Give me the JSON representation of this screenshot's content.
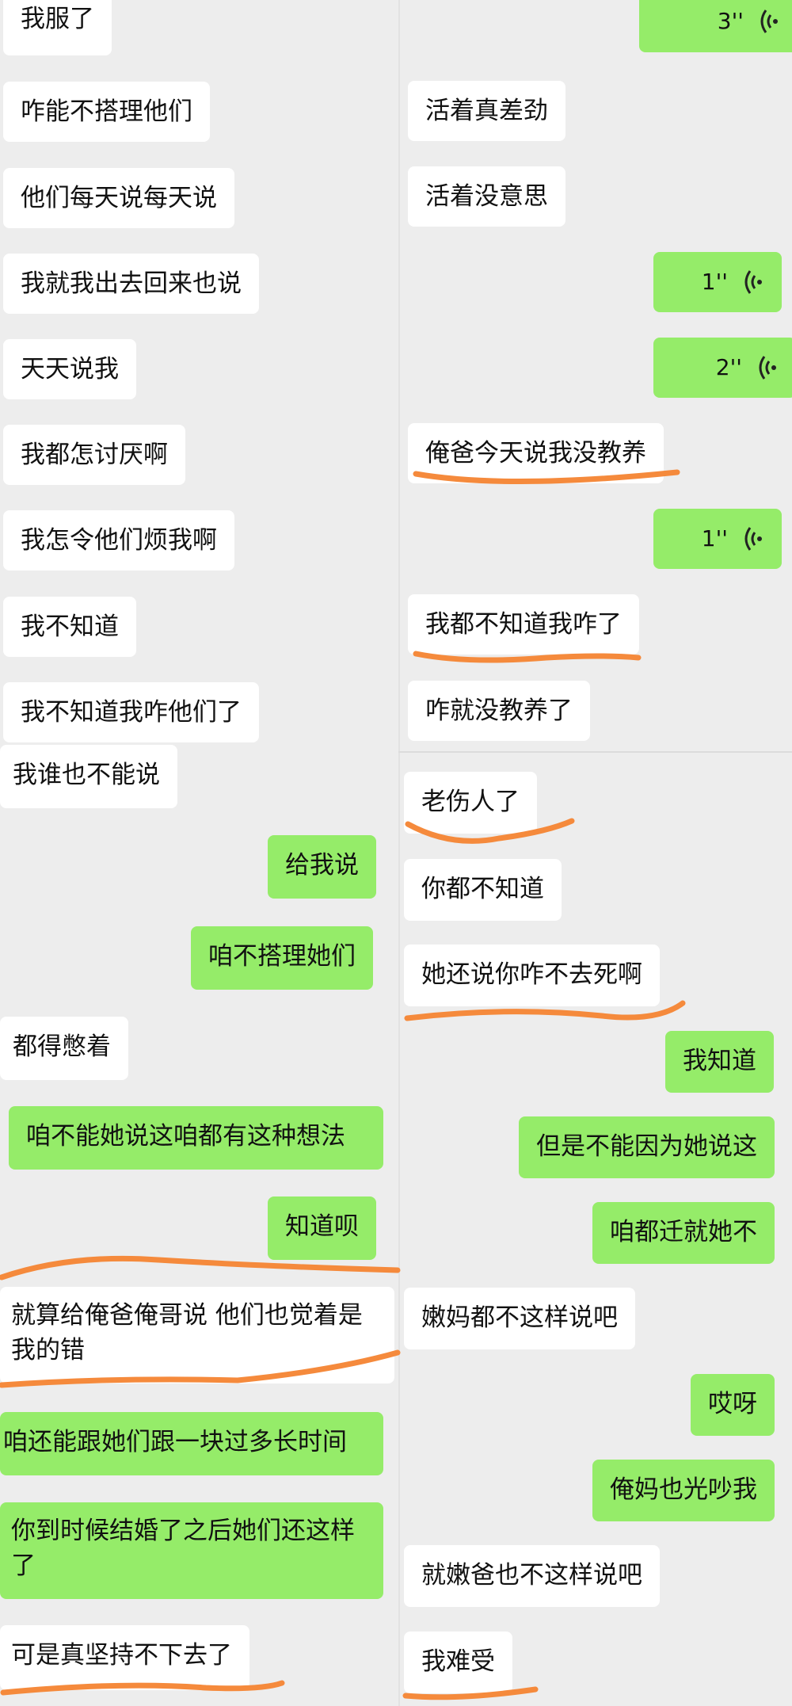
{
  "left_top": {
    "messages": [
      {
        "text": "我服了"
      },
      {
        "text": "咋能不搭理他们"
      },
      {
        "text": "他们每天说每天说"
      },
      {
        "text": "我就我出去回来也说"
      },
      {
        "text": "天天说我"
      },
      {
        "text": "我都怎讨厌啊"
      },
      {
        "text": "我怎令他们烦我啊"
      },
      {
        "text": "我不知道"
      },
      {
        "text": "我不知道我咋他们了"
      }
    ]
  },
  "right_top": {
    "voice_1": {
      "duration": "3''"
    },
    "messages": [
      {
        "text": "活着真差劲"
      },
      {
        "text": "活着没意思"
      }
    ],
    "voice_2": {
      "duration": "1''"
    },
    "voice_3": {
      "duration": "2''"
    },
    "msg_3": {
      "text": "俺爸今天说我没教养"
    },
    "voice_4": {
      "duration": "1''"
    },
    "msg_4": {
      "text": "我都不知道我咋了"
    },
    "msg_5": {
      "text": "咋就没教养了"
    }
  },
  "left_bottom": {
    "m1": {
      "text": "我谁也不能说"
    },
    "m2": {
      "text": "给我说"
    },
    "m3": {
      "text": "咱不搭理她们"
    },
    "m4": {
      "text": "都得憋着"
    },
    "m5": {
      "text": "咱不能她说这咱都有这种想法"
    },
    "m6": {
      "text": "知道呗"
    },
    "m7": {
      "text": "就算给俺爸俺哥说 他们也觉着是我的错"
    },
    "m8": {
      "text": "咱还能跟她们跟一块过多长时间"
    },
    "m9": {
      "text": "你到时候结婚了之后她们还这样了"
    },
    "m10": {
      "text": "可是真坚持不下去了"
    }
  },
  "right_bottom": {
    "m1": {
      "text": "老伤人了"
    },
    "m2": {
      "text": "你都不知道"
    },
    "m3": {
      "text": "她还说你咋不去死啊"
    },
    "m4": {
      "text": "我知道"
    },
    "m5": {
      "text": "但是不能因为她说这"
    },
    "m6": {
      "text": "咱都迁就她不"
    },
    "m7": {
      "text": "嫩妈都不这样说吧"
    },
    "m8": {
      "text": "哎呀"
    },
    "m9": {
      "text": "俺妈也光吵我"
    },
    "m10": {
      "text": "就嫩爸也不这样说吧"
    },
    "m11": {
      "text": "我难受"
    }
  },
  "colors": {
    "background": "#ededed",
    "incoming_bubble": "#ffffff",
    "outgoing_bubble": "#95ec69",
    "annotation": "#f58a3c"
  },
  "icons": {
    "voice": "voice-wave-icon"
  }
}
